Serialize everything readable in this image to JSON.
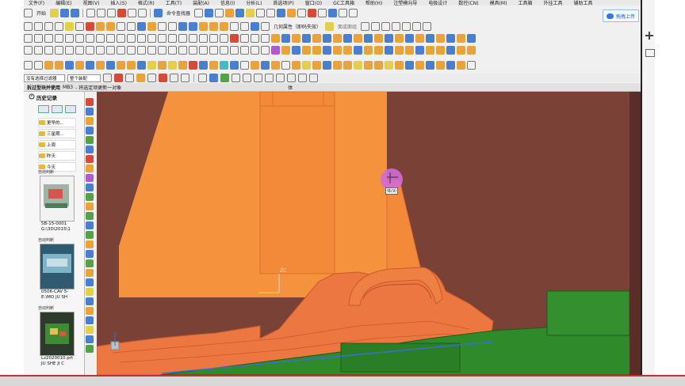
{
  "menu": [
    "文件(F)",
    "编辑(E)",
    "视图(V)",
    "插入(S)",
    "格式(R)",
    "工具(T)",
    "装配(A)",
    "信息(I)",
    "分析(L)",
    "首选项(P)",
    "窗口(O)",
    "GC工具箱",
    "帮助(H)",
    "注塑模向导",
    "电极设计",
    "数控(CN)",
    "模具(M)",
    "工具箱",
    "外挂工具",
    "辅助工具"
  ],
  "toolbar": {
    "start_label": "开始",
    "command_finder_label": "命令查找器",
    "geometry_property_label": "几何属性（即码失效）",
    "image_capture_label": "面或面组"
  },
  "upload_label": "拖拽上传",
  "selection_bar": {
    "filter_value": "没有选择过滤器",
    "scope_value": "整个装配"
  },
  "title_bar": {
    "left": "拆过型块并使用",
    "left_extra": "MB3",
    "middle": "- 将选定项更新一对象",
    "center": "体"
  },
  "history": {
    "title": "历史记录",
    "groups": [
      "更早的...",
      "三星期...",
      "上周",
      "昨天",
      "今天"
    ],
    "thumb_header": "自动判断",
    "thumbnails": [
      {
        "name": "SB-15-0001\nG:\\3D\\2015\\1"
      },
      {
        "name": "0506-CAV 5-\nE:\\MO JU SH"
      },
      {
        "name": "Lz2020010.prt\nJU SHE JI C"
      }
    ]
  },
  "viewport": {
    "cursor_tip": "体(9)",
    "axis_zc": "ZC",
    "colors": {
      "background": "#7a4136",
      "orange_part": "#f08a3c",
      "dark_orange": "#e8733a",
      "green_part": "#2e8a2a"
    }
  }
}
